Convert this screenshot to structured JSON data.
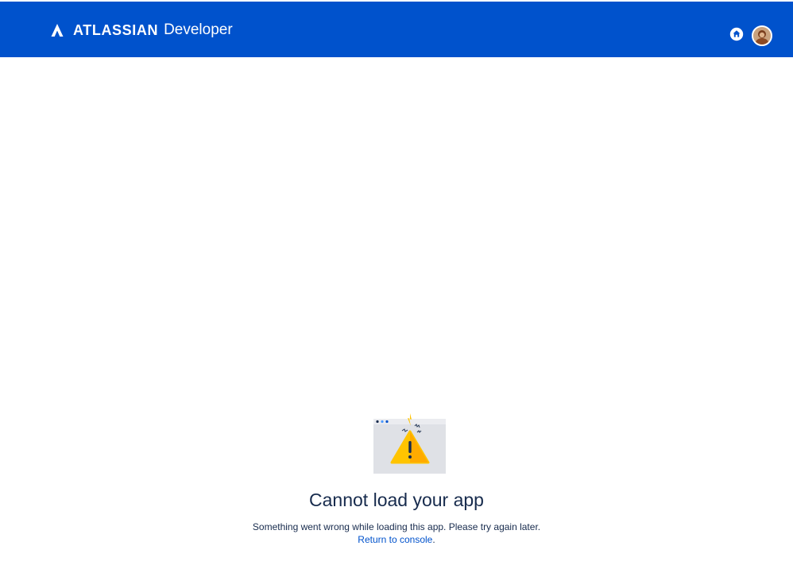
{
  "header": {
    "brand_name": "ATLASSIAN",
    "product_name": "Developer",
    "logo_icon": "atlassian-logo-icon",
    "home_icon": "home-icon",
    "avatar_icon": "user-avatar"
  },
  "colors": {
    "header_background": "#0052cc",
    "title_text": "#172b4d",
    "link": "#0052cc",
    "warning": "#ffc400"
  },
  "error": {
    "illustration_icon": "warning-browser-illustration",
    "title": "Cannot load your app",
    "message": "Something went wrong while loading this app. Please try again later.",
    "link_label": "Return to console",
    "link_suffix": "."
  }
}
